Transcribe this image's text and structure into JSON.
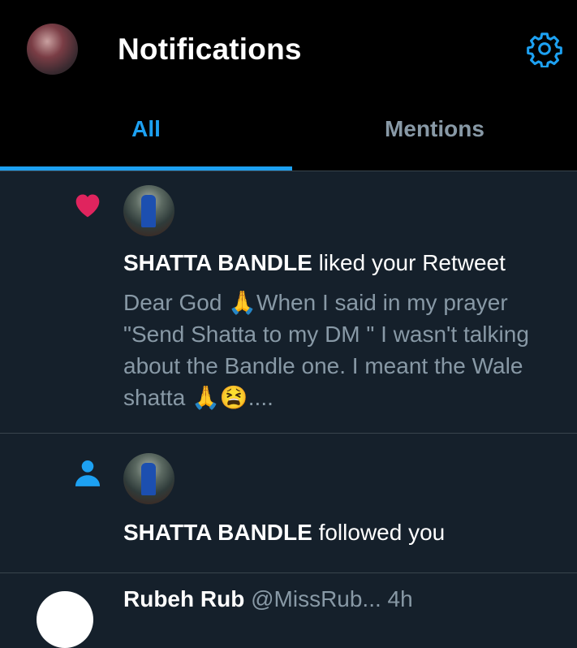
{
  "header": {
    "title": "Notifications",
    "settings_icon": "gear-icon"
  },
  "tabs": [
    {
      "label": "All",
      "active": true
    },
    {
      "label": "Mentions",
      "active": false
    }
  ],
  "notifications": [
    {
      "type": "like",
      "icon": "heart-icon",
      "user": "SHATTA BANDLE",
      "action": "liked your Retweet",
      "tweet_lines": [
        "Dear God 🙏When I said in my prayer",
        "\"Send Shatta to my DM \" I wasn't talking",
        "about the Bandle one. I meant the Wale",
        "shatta 🙏😫...."
      ]
    },
    {
      "type": "follow",
      "icon": "person-icon",
      "user": "SHATTA BANDLE",
      "action": "followed you"
    }
  ],
  "partial_row": {
    "name": "Rubeh Rub",
    "handle": "@MissRub... 4h"
  },
  "colors": {
    "accent": "#1da1f2",
    "like": "#e0245e",
    "background": "#15202b",
    "header": "#000000"
  }
}
